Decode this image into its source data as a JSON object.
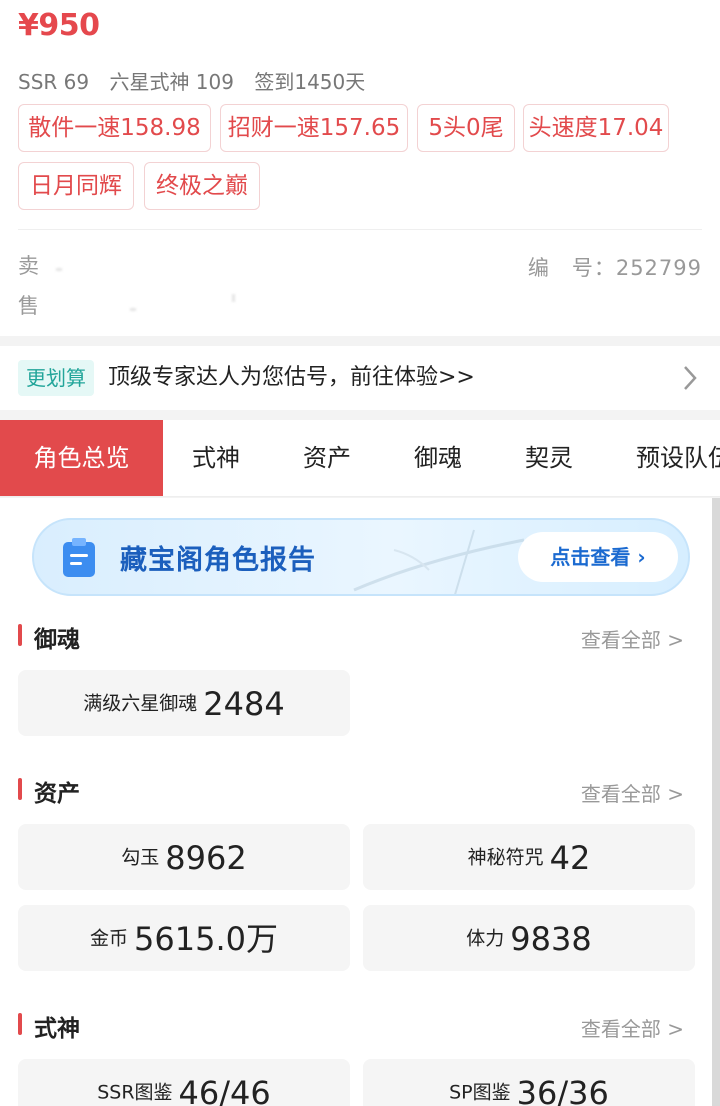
{
  "price": "¥950",
  "summary": [
    "SSR 69",
    "六星式神 109",
    "签到1450天"
  ],
  "tags": [
    "散件一速158.98",
    "招财一速157.65",
    "5头0尾",
    "头速度17.04",
    "日月同辉",
    "终极之巅"
  ],
  "seller": {
    "line1": "卖",
    "line2": "售已"
  },
  "serial": "编　号：252799",
  "promo": {
    "badge": "更划算",
    "text": "顶级专家达人为您估号，前往体验>>"
  },
  "tabs": [
    "角色总览",
    "式神",
    "资产",
    "御魂",
    "契灵",
    "预设队伍"
  ],
  "report": {
    "title": "藏宝阁角色报告",
    "button": "点击查看"
  },
  "sections": {
    "yuhun": {
      "title": "御魂",
      "more": "查看全部 >",
      "stats": [
        {
          "label": "满级六星御魂",
          "value": "2484"
        }
      ]
    },
    "assets": {
      "title": "资产",
      "more": "查看全部 >",
      "stats": [
        {
          "label": "勾玉",
          "value": "8962"
        },
        {
          "label": "神秘符咒",
          "value": "42"
        },
        {
          "label": "金币",
          "value": "5615.0万"
        },
        {
          "label": "体力",
          "value": "9838"
        }
      ]
    },
    "shishen": {
      "title": "式神",
      "more": "查看全部 >",
      "stats": [
        {
          "label": "SSR图鉴",
          "value": "46/46"
        },
        {
          "label": "SP图鉴",
          "value": "36/36"
        }
      ]
    }
  },
  "colors": {
    "accent": "#e24a4c",
    "teal": "#22a59a",
    "blue": "#1b5fbd"
  }
}
